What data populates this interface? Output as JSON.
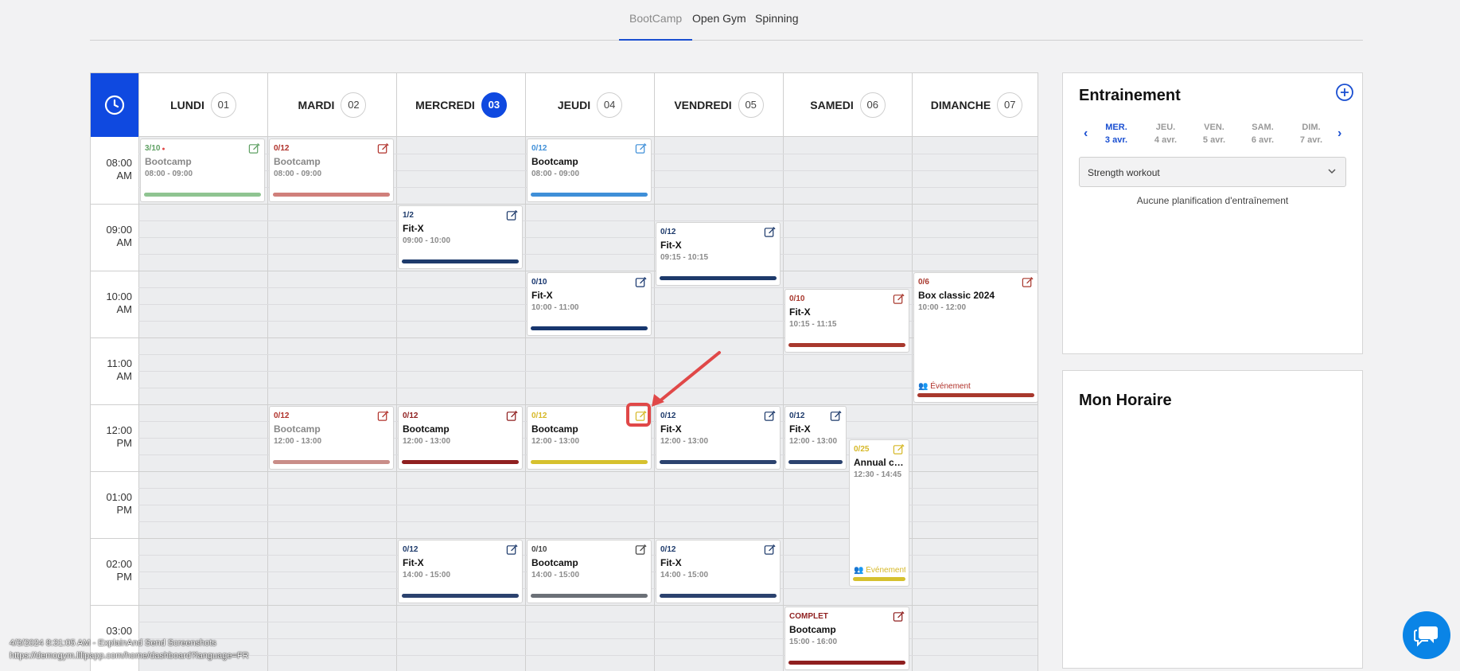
{
  "tabs": [
    {
      "label": "BootCamp",
      "active": true
    },
    {
      "label": "Open Gym",
      "active": false
    },
    {
      "label": "Spinning",
      "active": false
    }
  ],
  "days": [
    {
      "name": "LUNDI",
      "num": "01",
      "today": false
    },
    {
      "name": "MARDI",
      "num": "02",
      "today": false
    },
    {
      "name": "MERCREDI",
      "num": "03",
      "today": true
    },
    {
      "name": "JEUDI",
      "num": "04",
      "today": false
    },
    {
      "name": "VENDREDI",
      "num": "05",
      "today": false
    },
    {
      "name": "SAMEDI",
      "num": "06",
      "today": false
    },
    {
      "name": "DIMANCHE",
      "num": "07",
      "today": false
    }
  ],
  "times": [
    {
      "h": "08:00",
      "p": "AM"
    },
    {
      "h": "09:00",
      "p": "AM"
    },
    {
      "h": "10:00",
      "p": "AM"
    },
    {
      "h": "11:00",
      "p": "AM"
    },
    {
      "h": "12:00",
      "p": "PM"
    },
    {
      "h": "01:00",
      "p": "PM"
    },
    {
      "h": "02:00",
      "p": "PM"
    },
    {
      "h": "03:00",
      "p": ""
    }
  ],
  "events": [
    {
      "day": 0,
      "start": 8.0,
      "end": 9.0,
      "count": "3/10",
      "dot": true,
      "title": "Bootcamp",
      "time": "08:00 - 09:00",
      "color": "#5fa063",
      "bar": "#8fc491",
      "past": true
    },
    {
      "day": 1,
      "start": 8.0,
      "end": 9.0,
      "count": "0/12",
      "title": "Bootcamp",
      "time": "08:00 - 09:00",
      "color": "#b0312a",
      "bar": "#d07f7b",
      "past": true
    },
    {
      "day": 3,
      "start": 8.0,
      "end": 9.0,
      "count": "0/12",
      "title": "Bootcamp",
      "time": "08:00 - 09:00",
      "color": "#3f8fd8",
      "bar": "#3f8fd8"
    },
    {
      "day": 2,
      "start": 9.0,
      "end": 10.0,
      "count": "1/2",
      "title": "Fit-X",
      "time": "09:00 - 10:00",
      "color": "#1d3a6b",
      "bar": "#1d3a6b"
    },
    {
      "day": 4,
      "start": 9.25,
      "end": 10.25,
      "count": "0/12",
      "title": "Fit-X",
      "time": "09:15 - 10:15",
      "color": "#1d3a6b",
      "bar": "#1d3a6b"
    },
    {
      "day": 3,
      "start": 10.0,
      "end": 11.0,
      "count": "0/10",
      "title": "Fit-X",
      "time": "10:00 - 11:00",
      "color": "#17366e",
      "bar": "#17366e"
    },
    {
      "day": 5,
      "start": 10.25,
      "end": 11.25,
      "count": "0/10",
      "title": "Fit-X",
      "time": "10:15 - 11:15",
      "color": "#a8382d",
      "bar": "#a8382d"
    },
    {
      "day": 6,
      "start": 10.0,
      "end": 12.0,
      "count": "0/6",
      "title": "Box classic 2024",
      "time": "10:00 - 12:00",
      "color": "#a8382d",
      "bar": "#a8382d",
      "event_label": "Événement",
      "event_color": "#b0312a"
    },
    {
      "day": 1,
      "start": 12.0,
      "end": 13.0,
      "count": "0/12",
      "title": "Bootcamp",
      "time": "12:00 - 13:00",
      "color": "#b0312a",
      "bar": "#c98d88",
      "past": true
    },
    {
      "day": 2,
      "start": 12.0,
      "end": 13.0,
      "count": "0/12",
      "title": "Bootcamp",
      "time": "12:00 - 13:00",
      "color": "#8f1f1f",
      "bar": "#8f1f1f"
    },
    {
      "day": 3,
      "start": 12.0,
      "end": 13.0,
      "count": "0/12",
      "title": "Bootcamp",
      "time": "12:00 - 13:00",
      "color": "#d6b827",
      "bar": "#d6c12e"
    },
    {
      "day": 4,
      "start": 12.0,
      "end": 13.0,
      "count": "0/12",
      "title": "Fit-X",
      "time": "12:00 - 13:00",
      "color": "#1d3a6b",
      "bar": "#2b426e"
    },
    {
      "day": 5,
      "start": 12.0,
      "end": 13.0,
      "count": "0/12",
      "title": "Fit-X",
      "time": "12:00 - 13:00",
      "color": "#1d3a6b",
      "bar": "#2b426e",
      "half": "left"
    },
    {
      "day": 5,
      "start": 12.5,
      "end": 14.75,
      "count": "0/25",
      "title": "Annual competition",
      "time": "12:30 - 14:45",
      "color": "#d6b827",
      "bar": "#d6c12e",
      "half": "right",
      "event_label": "Événement",
      "event_color": "#d6b827"
    },
    {
      "day": 2,
      "start": 14.0,
      "end": 15.0,
      "count": "0/12",
      "title": "Fit-X",
      "time": "14:00 - 15:00",
      "color": "#1d3a6b",
      "bar": "#2b426e"
    },
    {
      "day": 3,
      "start": 14.0,
      "end": 15.0,
      "count": "0/10",
      "title": "Bootcamp",
      "time": "14:00 - 15:00",
      "color": "#444",
      "bar": "#6b7077"
    },
    {
      "day": 4,
      "start": 14.0,
      "end": 15.0,
      "count": "0/12",
      "title": "Fit-X",
      "time": "14:00 - 15:00",
      "color": "#1d3a6b",
      "bar": "#2b426e"
    },
    {
      "day": 5,
      "start": 15.0,
      "end": 16.0,
      "count": "COMPLET",
      "title": "Bootcamp",
      "time": "15:00 - 16:00",
      "color": "#8f1f1f",
      "bar": "#8f1f1f"
    }
  ],
  "training": {
    "title": "Entrainement",
    "week": [
      {
        "d": "MER.",
        "date": "3 avr.",
        "selected": true
      },
      {
        "d": "JEU.",
        "date": "4 avr.",
        "selected": false
      },
      {
        "d": "VEN.",
        "date": "5 avr.",
        "selected": false
      },
      {
        "d": "SAM.",
        "date": "6 avr.",
        "selected": false
      },
      {
        "d": "DIM.",
        "date": "7 avr.",
        "selected": false
      }
    ],
    "select_value": "Strength workout",
    "no_plan": "Aucune planification d'entraînement"
  },
  "schedule": {
    "title": "Mon Horaire"
  },
  "footer": {
    "line1": "4/3/2024 8:31:05 AM - ExplainAnd Send Screenshots",
    "line2": "https://demogym.lilipapp.com/home/dashboard?language=FR"
  },
  "colors": {
    "accent": "#0f49e0",
    "highlight": "#e04848",
    "chat": "#0a84e6"
  }
}
